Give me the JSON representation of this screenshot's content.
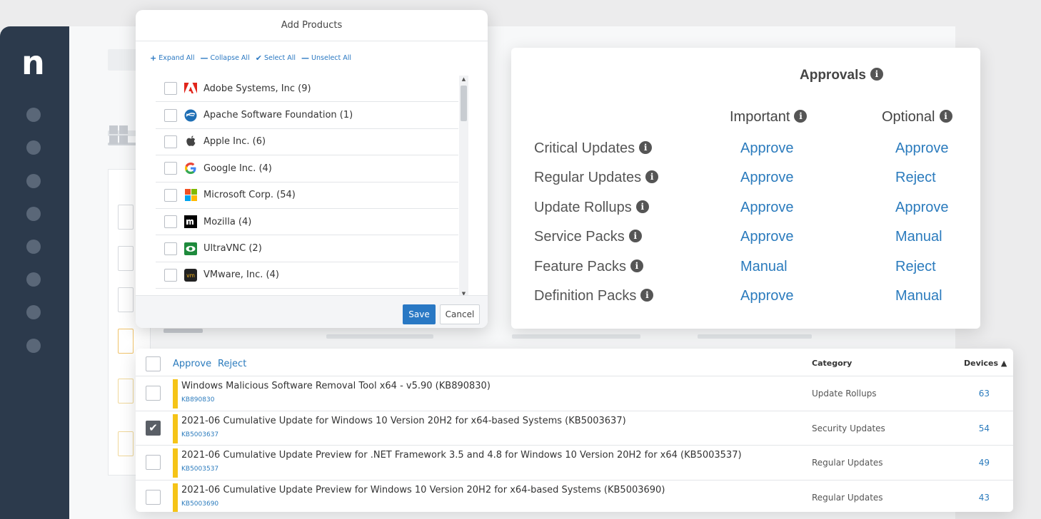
{
  "app": {
    "logo": "n"
  },
  "add_products": {
    "title": "Add Products",
    "actions": [
      {
        "symbol": "+",
        "label": "Expand All"
      },
      {
        "symbol": "—",
        "label": "Collapse All"
      },
      {
        "symbol": "✔",
        "label": "Select All"
      },
      {
        "symbol": "—",
        "label": "Unselect All"
      }
    ],
    "vendors": [
      {
        "label": "Adobe Systems, Inc (9)",
        "icon": "adobe-icon"
      },
      {
        "label": "Apache Software Foundation (1)",
        "icon": "apache-icon"
      },
      {
        "label": "Apple Inc. (6)",
        "icon": "apple-icon"
      },
      {
        "label": "Google Inc. (4)",
        "icon": "google-icon"
      },
      {
        "label": "Microsoft Corp. (54)",
        "icon": "microsoft-icon"
      },
      {
        "label": "Mozilla (4)",
        "icon": "mozilla-icon"
      },
      {
        "label": "UltraVNC (2)",
        "icon": "ultravnc-icon"
      },
      {
        "label": "VMware, Inc. (4)",
        "icon": "vmware-icon"
      }
    ],
    "save_label": "Save",
    "cancel_label": "Cancel"
  },
  "approvals": {
    "title": "Approvals",
    "columns": {
      "important": "Important",
      "optional": "Optional"
    },
    "rows": [
      {
        "label": "Critical Updates",
        "important": "Approve",
        "optional": "Approve"
      },
      {
        "label": "Regular Updates",
        "important": "Approve",
        "optional": "Reject"
      },
      {
        "label": "Update Rollups",
        "important": "Approve",
        "optional": "Approve"
      },
      {
        "label": "Service Packs",
        "important": "Approve",
        "optional": "Manual"
      },
      {
        "label": "Feature Packs",
        "important": "Manual",
        "optional": "Reject"
      },
      {
        "label": "Definition Packs",
        "important": "Approve",
        "optional": "Manual"
      }
    ]
  },
  "updates": {
    "approve_label": "Approve",
    "reject_label": "Reject",
    "category_header": "Category",
    "devices_header": "Devices ▲",
    "severity_color": "#f5c417",
    "rows": [
      {
        "checked": false,
        "title": "Windows Malicious Software Removal Tool x64 - v5.90 (KB890830)",
        "kb": "KB890830",
        "category": "Update Rollups",
        "devices": "63"
      },
      {
        "checked": true,
        "title": "2021-06 Cumulative Update for Windows 10 Version 20H2 for x64-based Systems (KB5003637)",
        "kb": "KB5003637",
        "category": "Security Updates",
        "devices": "54"
      },
      {
        "checked": false,
        "title": "2021-06 Cumulative Update Preview for .NET Framework 3.5 and 4.8 for Windows 10 Version 20H2 for x64 (KB5003537)",
        "kb": "KB5003537",
        "category": "Regular Updates",
        "devices": "49"
      },
      {
        "checked": false,
        "title": "2021-06 Cumulative Update Preview for Windows 10 Version 20H2 for x64-based Systems (KB5003690)",
        "kb": "KB5003690",
        "category": "Regular Updates",
        "devices": "43"
      }
    ]
  }
}
